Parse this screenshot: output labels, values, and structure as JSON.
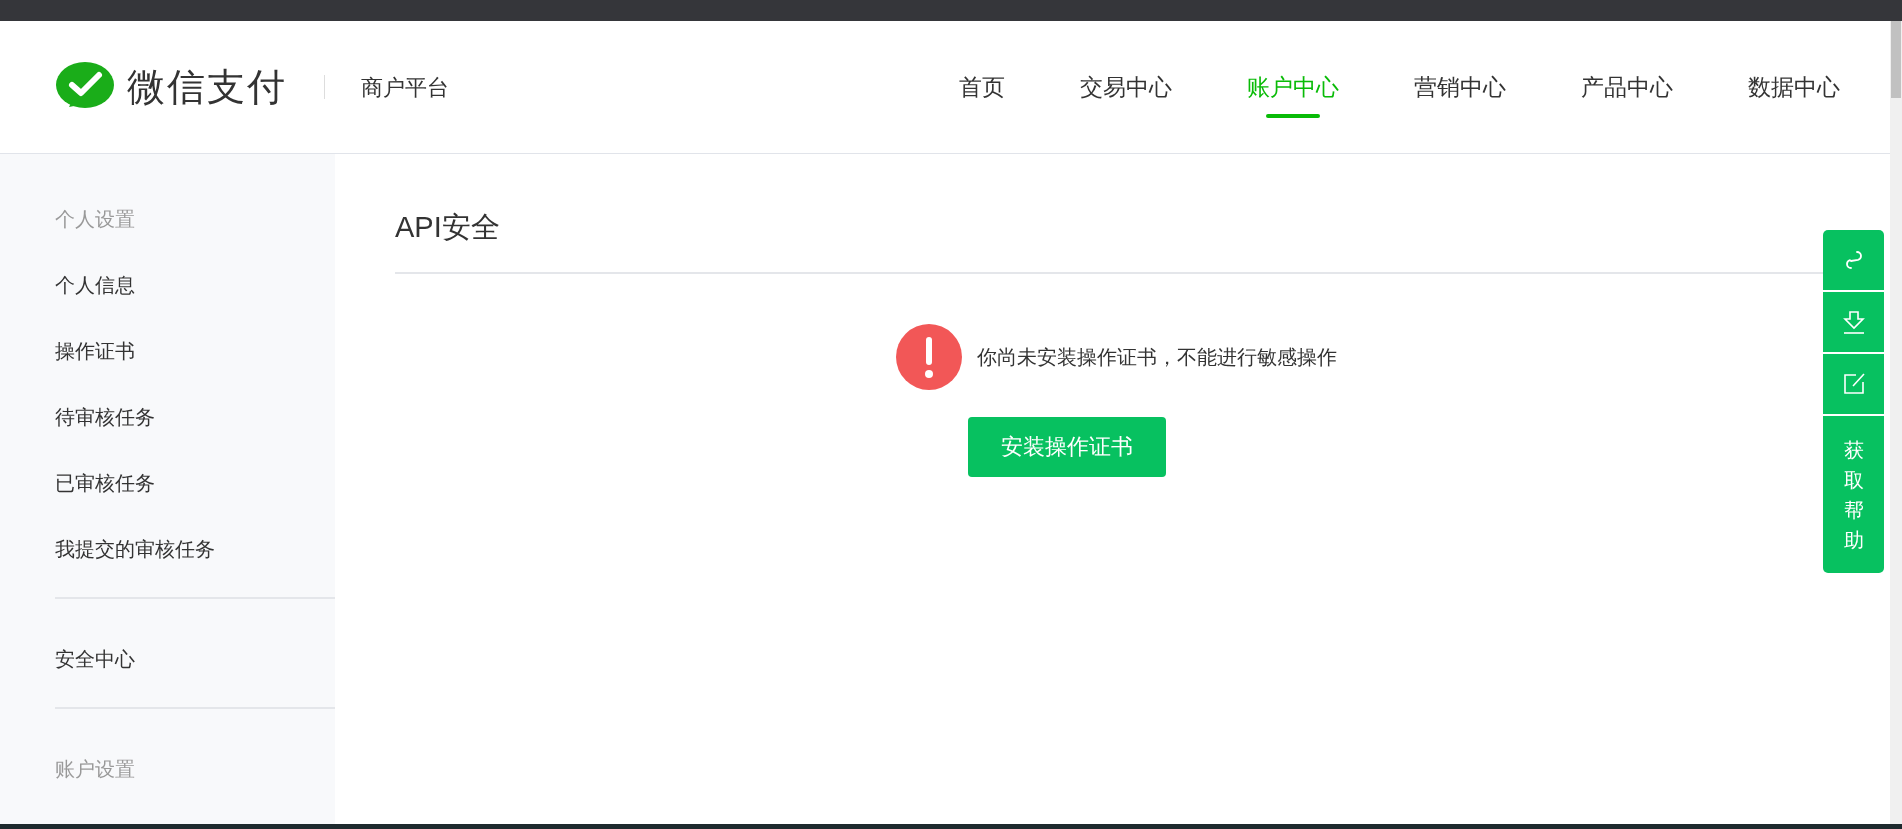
{
  "brand": {
    "name": "微信支付",
    "subtitle": "商户平台"
  },
  "nav": [
    {
      "label": "首页",
      "selected": false
    },
    {
      "label": "交易中心",
      "selected": false
    },
    {
      "label": "账户中心",
      "selected": true
    },
    {
      "label": "营销中心",
      "selected": false
    },
    {
      "label": "产品中心",
      "selected": false
    },
    {
      "label": "数据中心",
      "selected": false
    }
  ],
  "sidebar": {
    "groups": [
      {
        "title": "个人设置",
        "items": [
          "个人信息",
          "操作证书",
          "待审核任务",
          "已审核任务",
          "我提交的审核任务"
        ]
      },
      {
        "items": [
          "安全中心"
        ]
      },
      {
        "title": "账户设置"
      }
    ]
  },
  "main": {
    "title": "API安全",
    "alert": "你尚未安装操作证书，不能进行敏感操作",
    "button": "安装操作证书"
  },
  "float_bar": [
    {
      "kind": "link"
    },
    {
      "kind": "download"
    },
    {
      "kind": "edit"
    },
    {
      "kind": "text",
      "label": "获取帮助"
    }
  ]
}
